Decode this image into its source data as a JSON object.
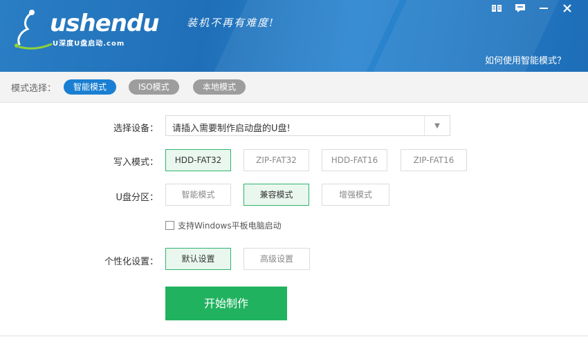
{
  "header": {
    "brand": "ushendu",
    "brand_sub": "U深度U盘启动.com",
    "slogan": "装机不再有难度!",
    "help_link": "如何使用智能模式？",
    "window_controls": [
      "book-icon",
      "feedback-icon",
      "minimize-icon",
      "close-icon"
    ]
  },
  "modebar": {
    "label": "模式选择：",
    "modes": [
      {
        "label": "智能模式",
        "active": true
      },
      {
        "label": "ISO模式",
        "active": false
      },
      {
        "label": "本地模式",
        "active": false
      }
    ]
  },
  "device": {
    "label": "选择设备：",
    "value": "请插入需要制作启动盘的U盘!"
  },
  "write_mode": {
    "label": "写入模式：",
    "options": [
      {
        "label": "HDD-FAT32",
        "selected": true
      },
      {
        "label": "ZIP-FAT32",
        "selected": false
      },
      {
        "label": "HDD-FAT16",
        "selected": false
      },
      {
        "label": "ZIP-FAT16",
        "selected": false
      }
    ]
  },
  "partition": {
    "label": "U盘分区：",
    "options": [
      {
        "label": "智能模式",
        "selected": false
      },
      {
        "label": "兼容模式",
        "selected": true
      },
      {
        "label": "增强模式",
        "selected": false
      }
    ],
    "checkbox_label": "支持Windows平板电脑启动"
  },
  "personalize": {
    "label": "个性化设置：",
    "options": [
      {
        "label": "默认设置",
        "selected": true
      },
      {
        "label": "高级设置",
        "selected": false
      }
    ]
  },
  "start_button": "开始制作",
  "colors": {
    "header": "#1f6fb8",
    "accent": "#1a7fd2",
    "green": "#21b25f"
  }
}
